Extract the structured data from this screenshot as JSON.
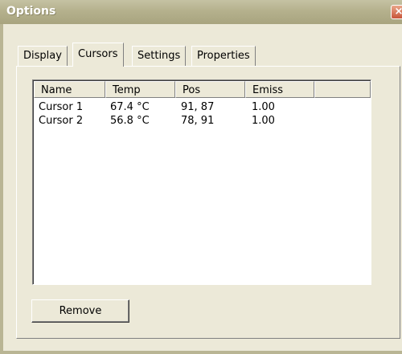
{
  "window": {
    "title": "Options",
    "close_glyph": "×"
  },
  "tabs": [
    {
      "label": "Display"
    },
    {
      "label": "Cursors",
      "active": true
    },
    {
      "label": "Settings"
    },
    {
      "label": "Properties"
    }
  ],
  "cursor_list": {
    "columns": [
      "Name",
      "Temp",
      "Pos",
      "Emiss"
    ],
    "rows": [
      [
        "Cursor 1",
        "67.4 °C",
        "91, 87",
        "1.00"
      ],
      [
        "Cursor 2",
        "56.8 °C",
        "78, 91",
        "1.00"
      ]
    ]
  },
  "buttons": {
    "remove": "Remove"
  },
  "icons": {
    "close": "close-icon"
  }
}
